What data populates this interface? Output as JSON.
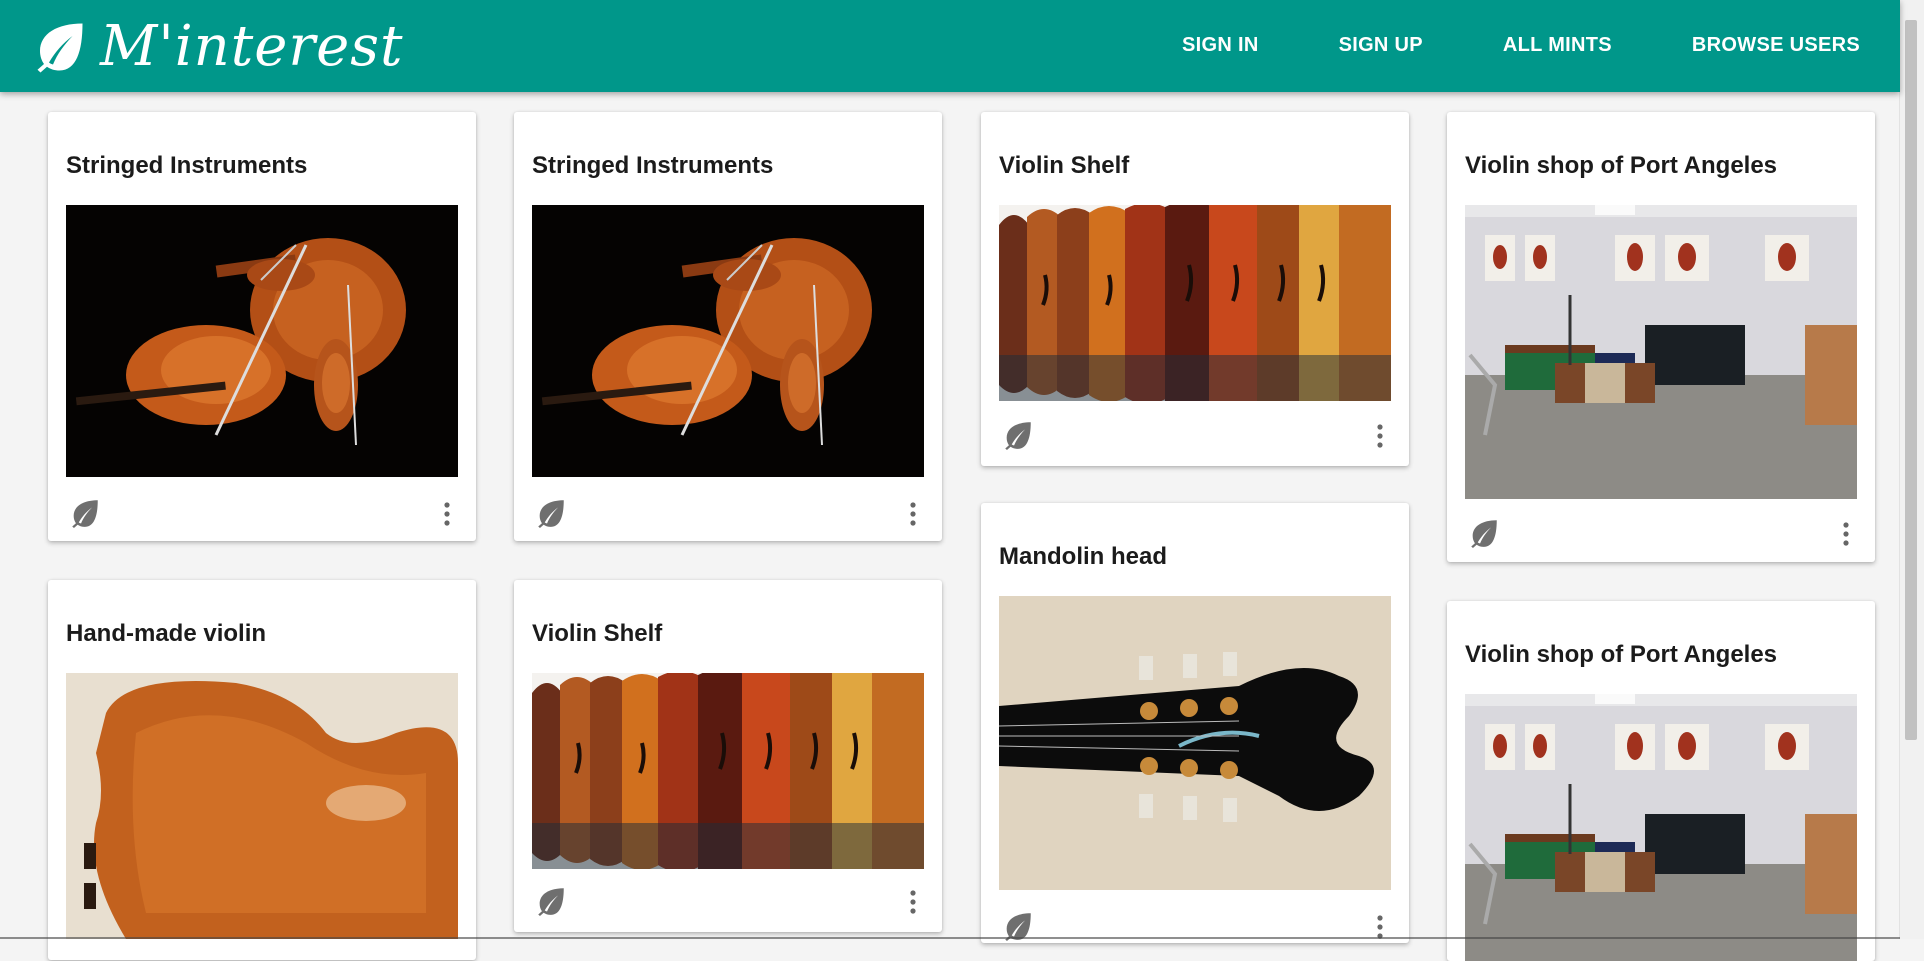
{
  "brand": {
    "name": "M'interest"
  },
  "nav": {
    "sign_in": "SIGN IN",
    "sign_up": "SIGN UP",
    "all_mints": "ALL MINTS",
    "browse_users": "BROWSE USERS"
  },
  "colors": {
    "primary": "#00978a",
    "icon": "#6f6f6f"
  },
  "icons": {
    "mint": "leaf-icon",
    "menu": "more-vert-icon"
  },
  "cards": [
    {
      "title": "Stringed Instruments",
      "image": "cello and violins on black background"
    },
    {
      "title": "Stringed Instruments",
      "image": "cello and violins on black background"
    },
    {
      "title": "Violin Shelf",
      "image": "row of violins hanging"
    },
    {
      "title": "Violin shop of Port Angeles",
      "image": "violin shop room interior"
    },
    {
      "title": "Hand-made violin",
      "image": "back of a violin"
    },
    {
      "title": "Violin Shelf",
      "image": "row of violins hanging"
    },
    {
      "title": "Mandolin head",
      "image": "mandolin headstock"
    },
    {
      "title": "Violin shop of Port Angeles",
      "image": "violin shop room interior"
    }
  ]
}
